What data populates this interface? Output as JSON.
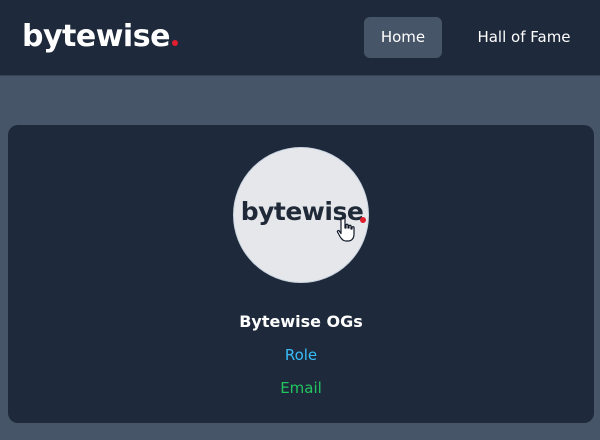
{
  "navbar": {
    "brand": "bytewise",
    "links": [
      "Home",
      "Hall of Fame"
    ],
    "active_link": "Home"
  },
  "card": {
    "avatar_logo_text": "bytewise",
    "name": "Bytewise OGs",
    "role": "Role",
    "email": "Email"
  },
  "colors": {
    "brand_dot": "#e11d2e",
    "role": "#38bdf8",
    "email": "#22c55e",
    "card_bg": "#1e293b",
    "page_bg": "#475569"
  },
  "icons": {
    "cursor": "hand-pointer-icon"
  }
}
